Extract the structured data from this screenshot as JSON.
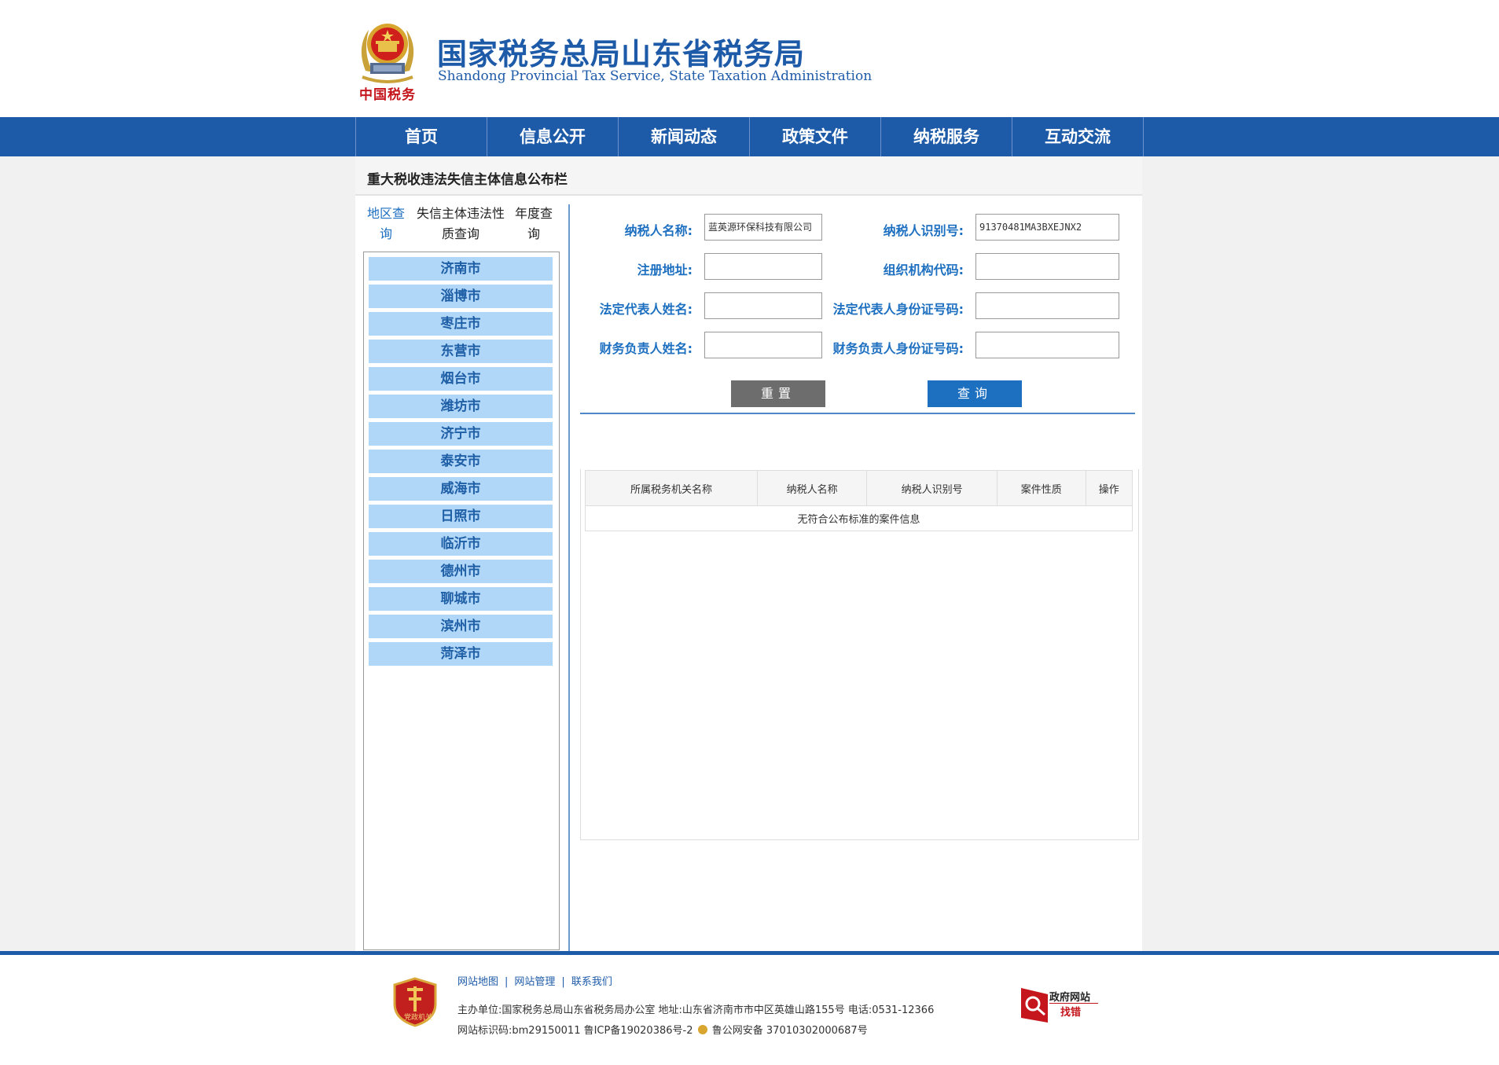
{
  "header": {
    "title_cn": "国家税务总局山东省税务局",
    "title_en": "Shandong Provincial Tax Service, State Taxation Administration",
    "emblem_caption": "中国税务"
  },
  "nav": {
    "items": [
      {
        "label": "首页"
      },
      {
        "label": "信息公开"
      },
      {
        "label": "新闻动态"
      },
      {
        "label": "政策文件"
      },
      {
        "label": "纳税服务"
      },
      {
        "label": "互动交流"
      }
    ]
  },
  "board": {
    "title": "重大税收违法失信主体信息公布栏"
  },
  "tabs": {
    "region": "地区查询",
    "nature": "失信主体违法性质查询",
    "year": "年度查询"
  },
  "cities": [
    "济南市",
    "淄博市",
    "枣庄市",
    "东营市",
    "烟台市",
    "潍坊市",
    "济宁市",
    "泰安市",
    "威海市",
    "日照市",
    "临沂市",
    "德州市",
    "聊城市",
    "滨州市",
    "菏泽市"
  ],
  "form": {
    "taxpayer_name_label": "纳税人名称:",
    "taxpayer_name_value": "蓝英源环保科技有限公司",
    "taxpayer_id_label": "纳税人识别号:",
    "taxpayer_id_value": "91370481MA3BXEJNX2",
    "reg_address_label": "注册地址:",
    "reg_address_value": "",
    "org_code_label": "组织机构代码:",
    "org_code_value": "",
    "legal_rep_name_label": "法定代表人姓名:",
    "legal_rep_name_value": "",
    "legal_rep_id_label": "法定代表人身份证号码:",
    "legal_rep_id_value": "",
    "finance_name_label": "财务负责人姓名:",
    "finance_name_value": "",
    "finance_id_label": "财务负责人身份证号码:",
    "finance_id_value": "",
    "reset_label": "重置",
    "query_label": "查询",
    "reset_color": "#6d6d6d",
    "query_color": "#1d6fc0"
  },
  "results": {
    "columns": [
      "所属税务机关名称",
      "纳税人名称",
      "纳税人识别号",
      "案件性质",
      "操作"
    ],
    "empty_message": "无符合公布标准的案件信息"
  },
  "footer": {
    "links": [
      "网站地图",
      "网站管理",
      "联系我们"
    ],
    "badge_caption": "党政机关",
    "sponsor": "主办单位:国家税务总局山东省税务局办公室 地址:山东省济南市市中区英雄山路155号 电话:0531-12366",
    "site_code": "网站标识码:bm29150011 鲁ICP备19020386号-2",
    "police_record": "鲁公网安备 37010302000687号",
    "gov_label_1": "政府网站",
    "gov_label_2": "找错"
  }
}
